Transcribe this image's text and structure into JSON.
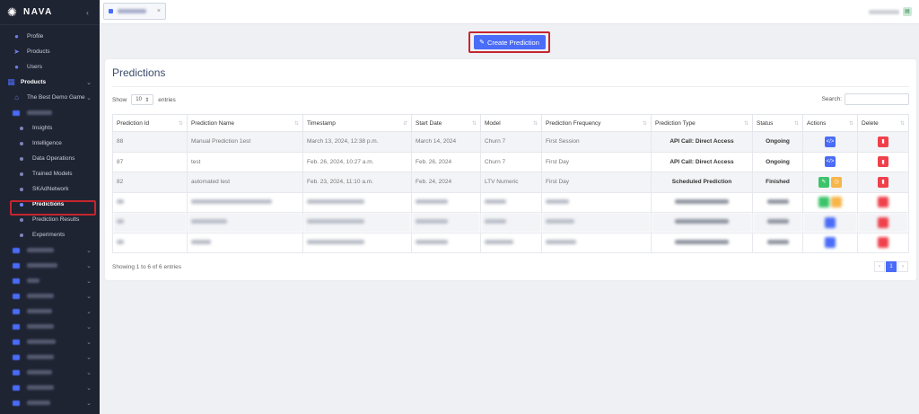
{
  "brand": {
    "name": "NAVA"
  },
  "sidebar": {
    "items": [
      {
        "label": "Profile",
        "icon": "user-icon"
      },
      {
        "label": "Products",
        "icon": "rocket-icon"
      },
      {
        "label": "Users",
        "icon": "users-icon"
      }
    ],
    "section": {
      "label": "Products",
      "icon": "sitemap-icon"
    },
    "game": {
      "label": "The Best Demo Game",
      "icon": "gamepad-icon"
    },
    "subitems": [
      {
        "label": "Insights"
      },
      {
        "label": "Intelligence"
      },
      {
        "label": "Data Operations"
      },
      {
        "label": "Trained Models"
      },
      {
        "label": "SKAdNetwork"
      },
      {
        "label": "Predictions"
      },
      {
        "label": "Prediction Results"
      },
      {
        "label": "Experiments"
      }
    ],
    "active_subitem": "Predictions"
  },
  "toolbar": {
    "create_label": "Create Prediction"
  },
  "card": {
    "title": "Predictions"
  },
  "list_controls": {
    "show_label": "Show",
    "entries_value": "10",
    "entries_label": "entries",
    "search_label": "Search:",
    "info": "Showing 1 to 6 of 6 entries",
    "page_prev": "‹",
    "page_current": "1",
    "page_next": "›"
  },
  "table": {
    "columns": [
      "Prediction Id",
      "Prediction Name",
      "Timestamp",
      "Start Date",
      "Model",
      "Prediction Frequency",
      "Prediction Type",
      "Status",
      "Actions",
      "Delete"
    ],
    "rows": [
      {
        "id": "88",
        "name": "Manual Prediction 1est",
        "timestamp": "March 13, 2024, 12:38 p.m.",
        "start": "March 14, 2024",
        "model": "Churn 7",
        "frequency": "First Session",
        "type": "API Call: Direct Access",
        "status": "Ongoing",
        "actions": [
          "code"
        ]
      },
      {
        "id": "87",
        "name": "test",
        "timestamp": "Feb. 26, 2024, 10:27 a.m.",
        "start": "Feb. 26, 2024",
        "model": "Churn 7",
        "frequency": "First Day",
        "type": "API Call: Direct Access",
        "status": "Ongoing",
        "actions": [
          "code"
        ]
      },
      {
        "id": "82",
        "name": "automated test",
        "timestamp": "Feb. 23, 2024, 11:10 a.m.",
        "start": "Feb. 24, 2024",
        "model": "LTV Numeric",
        "frequency": "First Day",
        "type": "Scheduled Prediction",
        "status": "Finished",
        "actions": [
          "edit",
          "clock"
        ]
      }
    ]
  },
  "colors": {
    "accent": "#4a6cf7",
    "danger": "#f0404b",
    "success": "#3cc46b",
    "warning": "#f7b54a",
    "sidebar_bg": "#1f2433",
    "highlight": "#c4262e"
  },
  "icons": {
    "create": "magic-wand-icon",
    "delete": "trash-icon",
    "code": "code-icon",
    "edit": "edit-icon",
    "clock": "clock-icon"
  }
}
